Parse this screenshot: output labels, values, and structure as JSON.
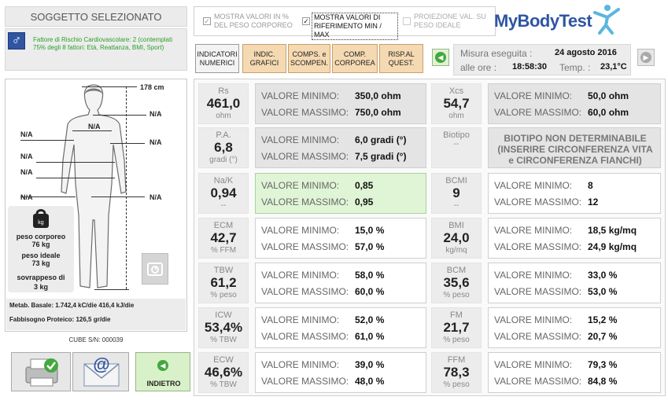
{
  "subject": {
    "title": "SOGGETTO SELEZIONATO",
    "gender_icon": "male-symbol-icon",
    "risk_text": "Fattore di Rischio Cardiovascolare: 2 (contemplati 75% degli 8 fattori: Età, Reattanza, BMI, Sport)"
  },
  "options": {
    "opt1": "MOSTRA VALORI IN % DEL PESO CORPOREO",
    "opt2": "MOSTRA VALORI DI RIFERIMENTO MIN / MAX",
    "opt3": "PROIEZIONE VAL. SU PESO IDEALE",
    "opt2_checked": "✓"
  },
  "logo": {
    "text": "MyBodyTest"
  },
  "tabs": [
    {
      "label": "INDICATORI NUMERICI"
    },
    {
      "label": "INDIC. GRAFICI"
    },
    {
      "label": "COMPS. e SCOMPEN."
    },
    {
      "label": "COMP. CORPOREA"
    },
    {
      "label": "RISP.AL QUEST."
    }
  ],
  "measure": {
    "label_date": "Misura eseguita :",
    "date": "24 agosto 2016",
    "label_time": "alle ore :",
    "time": "18:58:30",
    "label_temp": "Temp. :",
    "temp": "23,1°C"
  },
  "body": {
    "height": "178 cm",
    "na": "N/A",
    "peso_corporeo_label": "peso corporeo",
    "peso_corporeo": "76 kg",
    "peso_ideale_label": "peso ideale",
    "peso_ideale": "73 kg",
    "sovrappeso_label": "sovrappeso di",
    "sovrappeso": "3 kg"
  },
  "metab": {
    "basale": "Metab. Basale: 1.742,4 kC/die 416,4 kJ/die",
    "proteico": "Fabbisogno Proteico: 126,5 gr/die"
  },
  "serial": "CUBE S/N: 000039",
  "back_label": "INDIETRO",
  "labels": {
    "min": "VALORE MINIMO:",
    "max": "VALORE MASSIMO:"
  },
  "left_indicators": [
    {
      "name": "Rs",
      "value": "461,0",
      "unit": "ohm",
      "min": "350,0 ohm",
      "max": "750,0 ohm"
    },
    {
      "name": "P.A.",
      "value": "6,8",
      "unit": "gradi (°)",
      "min": "6,0 gradi (°)",
      "max": "7,5 gradi (°)"
    },
    {
      "name": "Na/K",
      "value": "0,94",
      "unit": "--",
      "min": "0,85",
      "max": "0,95"
    },
    {
      "name": "ECM",
      "value": "42,7",
      "unit": "% FFM",
      "min": "15,0 %",
      "max": "57,0 %"
    },
    {
      "name": "TBW",
      "value": "61,2",
      "unit": "% peso",
      "min": "58,0 %",
      "max": "60,0 %"
    },
    {
      "name": "ICW",
      "value": "53,4%",
      "unit": "% TBW",
      "min": "52,0 %",
      "max": "61,0 %"
    },
    {
      "name": "ECW",
      "value": "46,6%",
      "unit": "% TBW",
      "min": "39,0 %",
      "max": "48,0 %"
    }
  ],
  "right_indicators": [
    {
      "name": "Xcs",
      "value": "54,7",
      "unit": "ohm",
      "min": "50,0 ohm",
      "max": "60,0 ohm"
    },
    {
      "name": "Biotipo",
      "value": "",
      "unit": "--",
      "message": "BIOTIPO NON DETERMINABILE (INSERIRE CIRCONFERENZA VITA e CIRCONFERENZA FIANCHI)"
    },
    {
      "name": "BCMI",
      "value": "9",
      "unit": "--",
      "min": "8",
      "max": "12"
    },
    {
      "name": "BMI",
      "value": "24,0",
      "unit": "kg/mq",
      "min": "18,5 kg/mq",
      "max": "24,9 kg/mq"
    },
    {
      "name": "BCM",
      "value": "35,6",
      "unit": "% peso",
      "min": "33,0 %",
      "max": "53,0 %"
    },
    {
      "name": "FM",
      "value": "21,7",
      "unit": "% peso",
      "min": "15,2 %",
      "max": "20,7 %"
    },
    {
      "name": "FFM",
      "value": "78,3",
      "unit": "% peso",
      "min": "79,3 %",
      "max": "84,8 %"
    }
  ],
  "colors": {
    "accent_green": "#43a83e",
    "tab_orange": "#f5d9b2",
    "logo_blue": "#2f55a3"
  }
}
